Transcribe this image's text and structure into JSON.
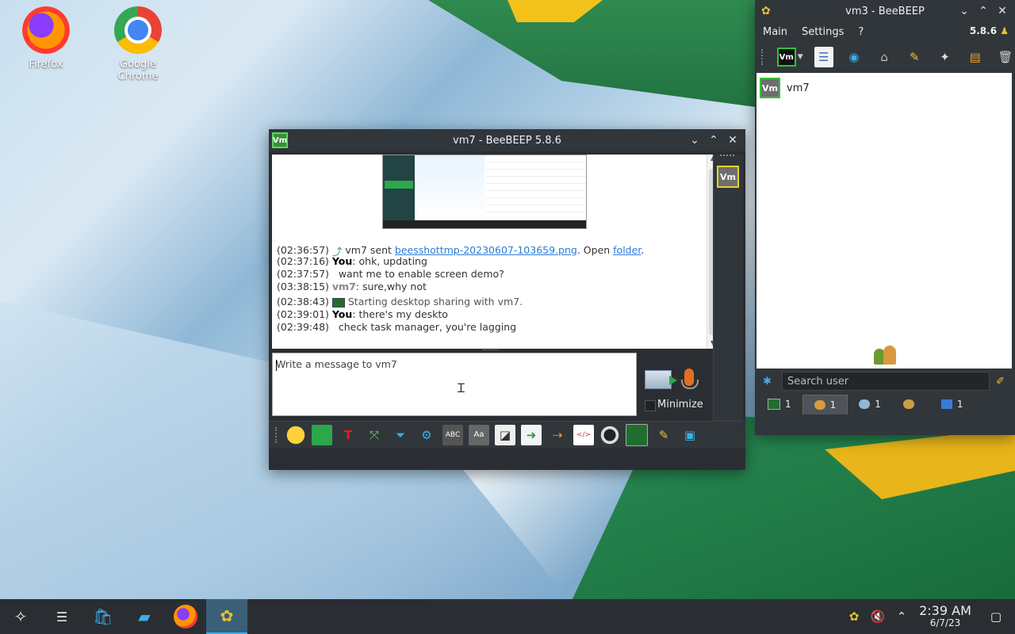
{
  "desktop": {
    "icons": [
      {
        "label": "Firefox"
      },
      {
        "label": "Google Chrome"
      }
    ]
  },
  "chat_window": {
    "title": "vm7 - BeeBEEP 5.8.6",
    "badge": "Vm",
    "messages": [
      {
        "time": "(02:36:57)",
        "prefix": "vm7 sent ",
        "link": "beesshottmp-20230607-103659.png",
        "mid": ". Open ",
        "link2": "folder",
        "end": "."
      },
      {
        "time": "(02:37:16)",
        "speaker": "You",
        "text": ": ohk, updating"
      },
      {
        "time": "(02:37:57)",
        "text": "want me to enable screen demo?"
      },
      {
        "time": "(03:38:15)",
        "speaker": "vm7",
        "text": ": sure,why not"
      },
      {
        "time": "(02:38:43)",
        "text": "Starting desktop sharing with vm7."
      },
      {
        "time": "(02:39:01)",
        "speaker": "You",
        "text": ": there's my deskto"
      },
      {
        "time": "(02:39:48)",
        "text": "check task manager, you're lagging"
      }
    ],
    "input_placeholder": "Write a message to vm7",
    "minimize_label": "Minimize",
    "side_badge": "Vm",
    "toolbar_icons": [
      "emoticon-icon",
      "mail-icon",
      "font-color-icon",
      "share-icon",
      "filter-icon",
      "settings-icon",
      "spellcheck-icon",
      "font-icon",
      "clear-icon",
      "send-file-icon",
      "file-transfer-icon",
      "html-icon",
      "screenshot-icon",
      "desktop-share-icon",
      "edit-icon",
      "window-icon"
    ]
  },
  "main_window": {
    "title": "vm3 - BeeBEEP",
    "menu": [
      "Main",
      "Settings",
      "?"
    ],
    "version": "5.8.6",
    "users": [
      {
        "badge": "Vm",
        "name": "vm7"
      }
    ],
    "search_placeholder": "Search user",
    "tabs": [
      {
        "count": "1",
        "icon": "chat-icon"
      },
      {
        "count": "1",
        "icon": "users-icon"
      },
      {
        "count": "1",
        "icon": "message-icon"
      },
      {
        "count": "",
        "icon": "groups-icon"
      },
      {
        "count": "1",
        "icon": "files-icon"
      }
    ]
  },
  "taskbar": {
    "time": "2:39 AM",
    "date": "6/7/23"
  },
  "colors": {
    "accent": "#3daee9",
    "link": "#2b7bd6",
    "titlebar": "#31363b",
    "badge_green": "#3a8b3a"
  }
}
